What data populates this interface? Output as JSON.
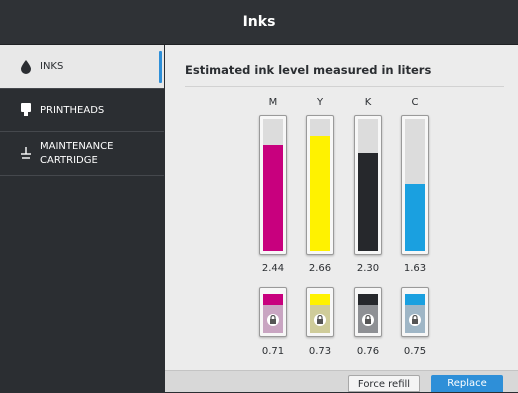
{
  "window": {
    "title": "Inks"
  },
  "sidebar": {
    "items": [
      {
        "label": "INKS",
        "icon": "ink-drop-icon",
        "active": true
      },
      {
        "label": "PRINTHEADS",
        "icon": "printhead-icon",
        "active": false
      },
      {
        "label_line1": "MAINTENANCE",
        "label_line2": "CARTRIDGE",
        "icon": "maintenance-cartridge-icon",
        "active": false
      }
    ]
  },
  "main": {
    "heading": "Estimated ink level measured in liters",
    "cartridges": [
      {
        "letter": "M",
        "value": "2.44",
        "level": 0.8,
        "color": "#c8007e"
      },
      {
        "letter": "Y",
        "value": "2.66",
        "level": 0.87,
        "color": "#fff200"
      },
      {
        "letter": "K",
        "value": "2.30",
        "level": 0.74,
        "color": "#26282c"
      },
      {
        "letter": "C",
        "value": "1.63",
        "level": 0.51,
        "color": "#1aa0e0"
      }
    ],
    "printheads": [
      {
        "value": "0.71",
        "color": "#c8007e",
        "body_color": "#c9a5c2"
      },
      {
        "value": "0.73",
        "color": "#fff200",
        "body_color": "#cfcc9a"
      },
      {
        "value": "0.76",
        "color": "#26282c",
        "body_color": "#8e9094"
      },
      {
        "value": "0.75",
        "color": "#1aa0e0",
        "body_color": "#9fb6c6"
      }
    ]
  },
  "buttons": {
    "force_refill": "Force refill",
    "replace": "Replace"
  },
  "colors": {
    "accent": "#2e8fd8",
    "dark_bg": "#2b2e32",
    "panel_bg": "#ececec"
  }
}
